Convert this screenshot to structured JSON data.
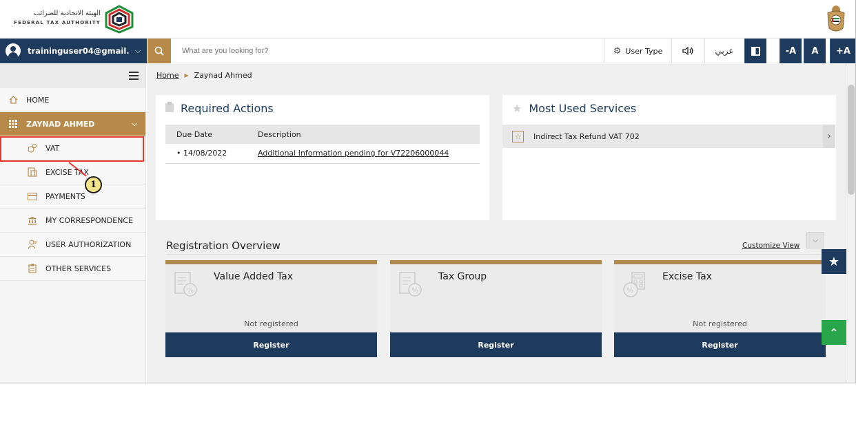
{
  "header": {
    "logo_ar": "الهيئة الاتحادية للضرائب",
    "logo_en": "FEDERAL TAX AUTHORITY"
  },
  "navbar": {
    "user_email": "traininguser04@gmail.c...",
    "search_placeholder": "What are you looking for?",
    "user_type_label": "User Type",
    "language_label": "عربي",
    "font_decrease": "-A",
    "font_reset": "A",
    "font_increase": "+A"
  },
  "sidebar": {
    "home": "HOME",
    "group": "ZAYNAD AHMED",
    "items": [
      {
        "label": "VAT",
        "icon": "coins-icon"
      },
      {
        "label": "EXCISE TAX",
        "icon": "excise-icon"
      },
      {
        "label": "PAYMENTS",
        "icon": "payments-icon"
      },
      {
        "label": "MY CORRESPONDENCE",
        "icon": "bank-icon"
      },
      {
        "label": "USER AUTHORIZATION",
        "icon": "user-auth-icon"
      },
      {
        "label": "OTHER SERVICES",
        "icon": "clipboard-icon"
      }
    ],
    "annotation_number": "1"
  },
  "breadcrumb": {
    "home": "Home",
    "current": "Zaynad Ahmed"
  },
  "required_actions": {
    "title": "Required Actions",
    "columns": [
      "Due Date",
      "Description"
    ],
    "rows": [
      {
        "due_date": "• 14/08/2022",
        "description": "Additional Information pending for V72206000044"
      }
    ]
  },
  "most_used": {
    "title": "Most Used Services",
    "items": [
      "Indirect Tax Refund VAT 702"
    ]
  },
  "registration": {
    "title": "Registration Overview",
    "customize_label": "Customize View",
    "cards": [
      {
        "title": "Value Added Tax",
        "status": "Not registered",
        "button": "Register"
      },
      {
        "title": "Tax Group",
        "status": "",
        "button": "Register"
      },
      {
        "title": "Excise Tax",
        "status": "Not registered",
        "button": "Register"
      }
    ]
  },
  "colors": {
    "navy": "#1e3a5c",
    "gold": "#b88a4a",
    "green": "#2aa64a",
    "highlight_red": "#e53935"
  }
}
